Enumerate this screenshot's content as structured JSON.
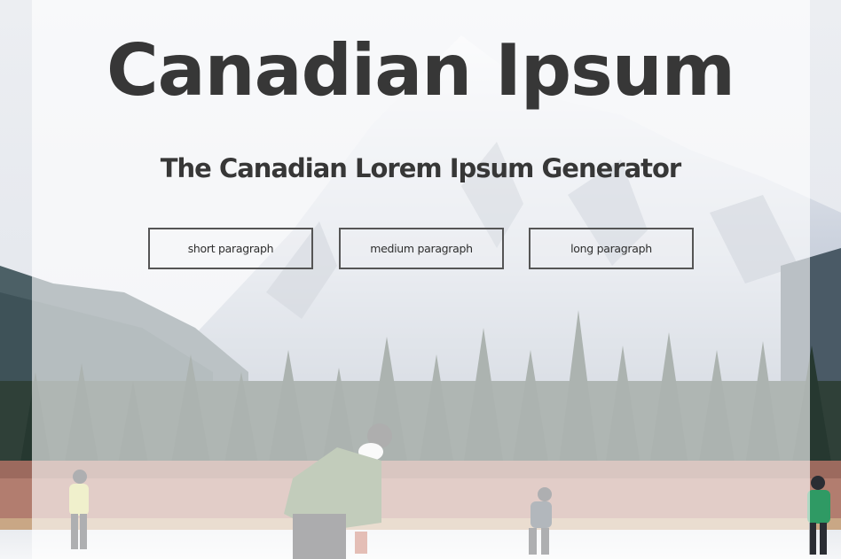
{
  "header": {
    "title": "Canadian Ipsum",
    "subtitle": "The Canadian Lorem Ipsum Generator"
  },
  "buttons": {
    "short_label": "short paragraph",
    "medium_label": "medium paragraph",
    "long_label": "long paragraph"
  },
  "colors": {
    "text": "#373737",
    "button_border": "#555555",
    "overlay": "rgba(255,255,255,0.62)"
  }
}
